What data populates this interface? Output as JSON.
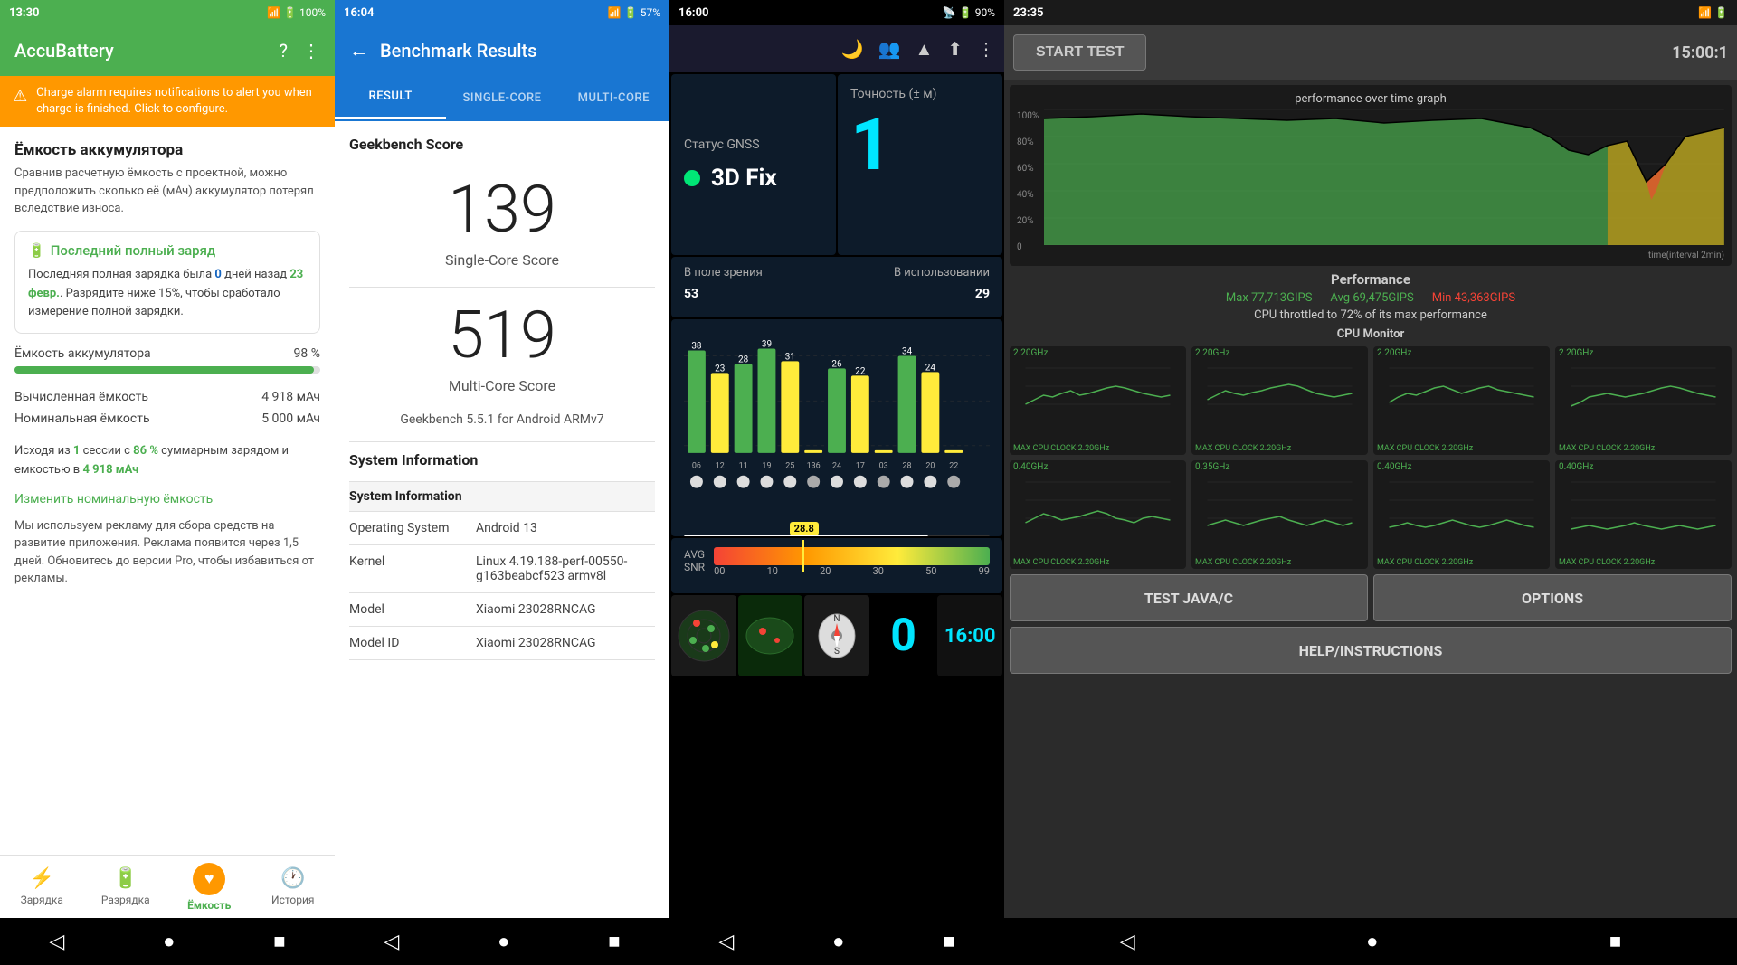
{
  "panel1": {
    "statusbar": {
      "time": "13:30",
      "battery": "100%"
    },
    "toolbar": {
      "title": "AccuBattery"
    },
    "alert": {
      "text": "Charge alarm requires notifications to alert you when charge is finished. Click to configure."
    },
    "section_title": "Ёмкость аккумулятора",
    "section_desc": "Сравнив расчетную ёмкость с проектной, можно предположить сколько её (мАч) аккумулятор потерял вследствие износа.",
    "last_charge": {
      "title": "Последний полный заряд",
      "text_part1": "Последняя полная зарядка была ",
      "days": "0",
      "text_part2": " дней назад ",
      "date": "23 февр.",
      "text_part3": ". Разрядите ниже 15%, чтобы сработало измерение полной зарядки."
    },
    "battery_capacity_label": "Ёмкость аккумулятора",
    "battery_capacity_pct": "98 %",
    "battery_capacity_pct_num": 98,
    "calculated_label": "Вычисленная ёмкость",
    "calculated_value": "4 918 мАч",
    "nominal_label": "Номинальная ёмкость",
    "nominal_value": "5 000 мАч",
    "session_text_part1": "Исходя из ",
    "sessions": "1",
    "session_text_part2": " сессии с ",
    "charge_pct": "86 %",
    "session_text_part3": " суммарным зарядом и емкостью в ",
    "capacity_value": "4 918 мАч",
    "change_link": "Изменить номинальную ёмкость",
    "ad_text": "Мы используем рекламу для сбора средств на развитие приложения. Реклама появится через 1,5 дней. Обновитесь до версии Pro, чтобы избавиться от рекламы.",
    "nav": {
      "charge": "Зарядка",
      "discharge": "Разрядка",
      "capacity": "Ёмкость",
      "history": "История"
    }
  },
  "panel2": {
    "statusbar": {
      "time": "16:04",
      "battery": "57%"
    },
    "toolbar": {
      "title": "Benchmark Results"
    },
    "tabs": [
      "RESULT",
      "SINGLE-CORE",
      "MULTI-CORE"
    ],
    "active_tab": "RESULT",
    "score_heading": "Geekbench Score",
    "single_core_score": "139",
    "single_core_label": "Single-Core Score",
    "multi_core_score": "519",
    "multi_core_label": "Multi-Core Score",
    "version_text": "Geekbench 5.5.1 for Android ARMv7",
    "sys_info_heading": "System Information",
    "sys_info_subheading": "System Information",
    "info_rows": [
      {
        "key": "Operating System",
        "value": "Android 13"
      },
      {
        "key": "Kernel",
        "value": "Linux 4.19.188-perf-00550-g163beabcf523 armv8l"
      },
      {
        "key": "Model",
        "value": "Xiaomi 23028RNCAG"
      },
      {
        "key": "Model ID",
        "value": "Xiaomi 23028RNCAG"
      }
    ]
  },
  "panel3": {
    "statusbar": {
      "time": "16:00",
      "battery": "90%"
    },
    "gnss_label": "Статус GNSS",
    "gnss_fix": "3D Fix",
    "accuracy_label": "Точность (± м)",
    "accuracy_value": "1",
    "in_view_label": "В поле зрения",
    "in_view_value": "53",
    "in_use_label": "В использовании",
    "in_use_value": "29",
    "bars": [
      {
        "id": "06",
        "value": 38,
        "color": "#4CAF50"
      },
      {
        "id": "12",
        "value": 23,
        "color": "#ffeb3b"
      },
      {
        "id": "11",
        "value": 28,
        "color": "#4CAF50"
      },
      {
        "id": "19",
        "value": 39,
        "color": "#4CAF50"
      },
      {
        "id": "25",
        "value": 31,
        "color": "#ffeb3b"
      },
      {
        "id": "136",
        "value": 0,
        "color": "#ffeb3b"
      },
      {
        "id": "24",
        "value": 26,
        "color": "#4CAF50"
      },
      {
        "id": "17",
        "value": 22,
        "color": "#ffeb3b"
      },
      {
        "id": "03",
        "value": 0,
        "color": "#ffeb3b"
      },
      {
        "id": "28",
        "value": 34,
        "color": "#4CAF50"
      },
      {
        "id": "20",
        "value": 24,
        "color": "#ffeb3b"
      },
      {
        "id": "22",
        "value": 0,
        "color": "#ffeb3b"
      }
    ],
    "snr_label": "AVG\nSNR",
    "snr_value": "28.8",
    "snr_position_pct": 32,
    "snr_scale": [
      "00",
      "10",
      "20",
      "30",
      "50",
      "99"
    ],
    "bottom_clock": "16:00"
  },
  "panel4": {
    "statusbar": {
      "time": "23:35",
      "battery": "▼"
    },
    "start_btn_label": "START TEST",
    "timer": "15:00:1",
    "graph_title": "performance over time graph",
    "y_labels": [
      "100%",
      "80%",
      "60%",
      "40%",
      "20%",
      "0"
    ],
    "x_label": "time(interval 2min)",
    "perf_title": "Performance",
    "perf_max": "Max 77,713GIPS",
    "perf_avg": "Avg 69,475GIPS",
    "perf_min": "Min 43,363GIPS",
    "perf_throttle": "CPU throttled to 72% of its max performance",
    "cpu_monitor_title": "CPU Monitor",
    "cpu_cores": [
      {
        "top_label": "2.20GHz",
        "bottom_label": "MAX CPU CLOCK 2.20GHz"
      },
      {
        "top_label": "2.20GHz",
        "bottom_label": "MAX CPU CLOCK 2.20GHz"
      },
      {
        "top_label": "2.20GHz",
        "bottom_label": "MAX CPU CLOCK 2.20GHz"
      },
      {
        "top_label": "2.20GHz",
        "bottom_label": "MAX CPU CLOCK 2.20GHz"
      },
      {
        "top_label": "0.40GHz",
        "bottom_label": "MAX CPU CLOCK 2.20GHz"
      },
      {
        "top_label": "0.35GHz",
        "bottom_label": "MAX CPU CLOCK 2.20GHz"
      },
      {
        "top_label": "0.40GHz",
        "bottom_label": "MAX CPU CLOCK 2.20GHz"
      },
      {
        "top_label": "0.40GHz",
        "bottom_label": "MAX CPU CLOCK 2.20GHz"
      }
    ],
    "btn_test_java": "TEST JAVA/C",
    "btn_options": "OPTIONS",
    "btn_help": "HELP/INSTRUCTIONS"
  }
}
